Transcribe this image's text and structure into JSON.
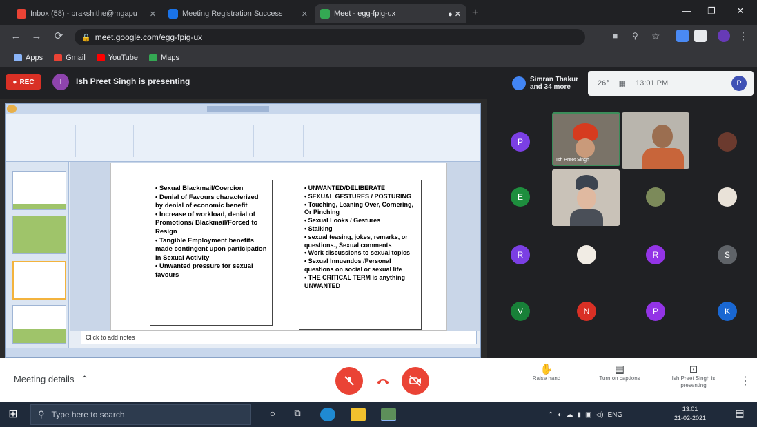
{
  "browser": {
    "tabs": [
      {
        "title": "Inbox (58) - prakshithe@mgapu",
        "favicon_color": "#ea4335",
        "active": false
      },
      {
        "title": "Meeting Registration Success",
        "favicon_color": "#1a73e8",
        "active": false
      },
      {
        "title": "Meet - egg-fpig-ux",
        "favicon_color": "#34a853",
        "active": true
      }
    ],
    "url": "meet.google.com/egg-fpig-ux",
    "bookmarks": [
      "Apps",
      "Gmail",
      "YouTube",
      "Maps"
    ]
  },
  "meet": {
    "rec_label": "REC",
    "presenter_initial": "I",
    "presenting_text": "Ish Preet Singh is presenting",
    "participants_chip": {
      "line1": "Simran Thakur",
      "line2": "and 34 more"
    },
    "widgets": {
      "temp": "26°",
      "time": "13:01 PM",
      "me_initial": "P"
    },
    "meeting_details": "Meeting details",
    "actions": {
      "raise_hand": "Raise hand",
      "captions": "Turn on captions",
      "presenting": "Ish Preet Singh is presenting"
    }
  },
  "slide": {
    "left_box": [
      "• Sexual Blackmail/Coercion",
      "• Denial of Favours characterized by denial of economic benefit",
      "• Increase of workload, denial of Promotions/ Blackmail/Forced to Resign",
      "• Tangible Employment benefits made contingent upon participation in Sexual Activity",
      "• Unwanted pressure for sexual favours"
    ],
    "right_box": [
      "• UNWANTED/DELIBERATE",
      "• SEXUAL GESTURES / POSTURING",
      "• Touching, Leaning Over, Cornering, Or Pinching",
      "• Sexual Looks / Gestures",
      "• Stalking",
      "• sexual teasing, jokes, remarks, or questions., Sexual comments",
      "• Work discussions to sexual topics",
      "• Sexual Innuendos /Personal questions on social or sexual life",
      "• THE CRITICAL TERM is anything UNWANTED"
    ],
    "notes_placeholder": "Click to add notes"
  },
  "participants": [
    {
      "initial": "P",
      "color": "#7b3fe4"
    },
    {
      "initial": "E",
      "color": "#1e8e3e"
    },
    {
      "initial": "R",
      "color": "#7b3fe4"
    },
    {
      "initial": "R",
      "color": "#9334e6"
    },
    {
      "initial": "S",
      "color": "#5f6368"
    },
    {
      "initial": "V",
      "color": "#188038"
    },
    {
      "initial": "N",
      "color": "#d93025"
    },
    {
      "initial": "P",
      "color": "#9334e6"
    },
    {
      "initial": "K",
      "color": "#1967d2"
    }
  ],
  "video_tiles": [
    {
      "name": "Ish Preet Singh"
    }
  ],
  "taskbar": {
    "search_placeholder": "Type here to search",
    "tray_lang": "ENG",
    "clock_time": "13:01",
    "clock_date": "21-02-2021"
  }
}
